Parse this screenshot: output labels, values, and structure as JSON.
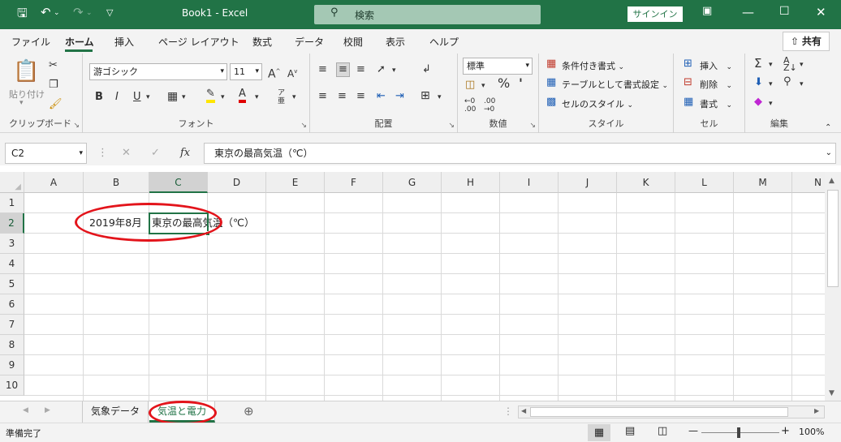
{
  "titlebar": {
    "title": "Book1 - Excel",
    "search_placeholder": "検索",
    "signin": "サインイン"
  },
  "menu": {
    "items": [
      "ファイル",
      "ホーム",
      "挿入",
      "ページ レイアウト",
      "数式",
      "データ",
      "校閲",
      "表示",
      "ヘルプ"
    ],
    "active": "ホーム",
    "share": "共有"
  },
  "ribbon": {
    "clipboard": {
      "label": "クリップボード",
      "paste": "貼り付け"
    },
    "font": {
      "label": "フォント",
      "font_name": "游ゴシック",
      "font_size": "11"
    },
    "alignment": {
      "label": "配置"
    },
    "number": {
      "label": "数値",
      "format": "標準"
    },
    "styles": {
      "label": "スタイル",
      "conditional": "条件付き書式",
      "table": "テーブルとして書式設定",
      "cell_style": "セルのスタイル"
    },
    "cells": {
      "label": "セル",
      "insert": "挿入",
      "delete": "削除",
      "format": "書式"
    },
    "editing": {
      "label": "編集"
    }
  },
  "formula_bar": {
    "name_box": "C2",
    "fx": "fx",
    "content": "東京の最高気温（℃）"
  },
  "grid": {
    "columns": [
      "A",
      "B",
      "C",
      "D",
      "E",
      "F",
      "G",
      "H",
      "I",
      "J",
      "K",
      "L",
      "M",
      "N"
    ],
    "rows": [
      "1",
      "2",
      "3",
      "4",
      "5",
      "6",
      "7",
      "8",
      "9",
      "10"
    ],
    "active_cell": "C2",
    "cells": {
      "B2": "2019年8月",
      "C2": "東京の最高気温（℃）"
    }
  },
  "sheets": {
    "tabs": [
      "気象データ",
      "気温と電力"
    ],
    "active": "気温と電力"
  },
  "status": {
    "ready": "準備完了",
    "zoom": "100%"
  },
  "colors": {
    "excel_green": "#217346",
    "annotation_red": "#e3141b"
  }
}
